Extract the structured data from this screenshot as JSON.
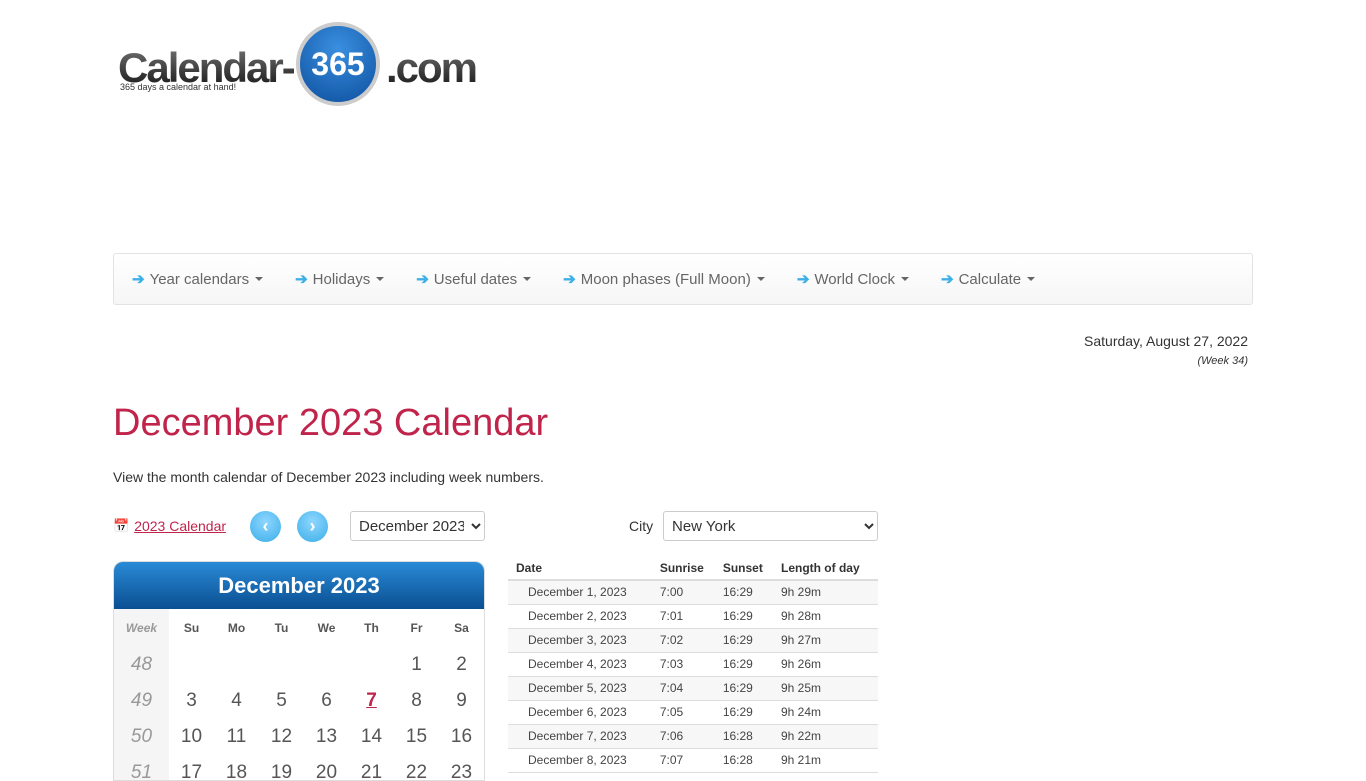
{
  "logo": {
    "left": "Calendar-",
    "number": "365",
    "right": ".com",
    "tagline": "365 days a calendar at hand!"
  },
  "nav": [
    {
      "label": "Year calendars"
    },
    {
      "label": "Holidays"
    },
    {
      "label": "Useful dates"
    },
    {
      "label": "Moon phases (Full Moon)"
    },
    {
      "label": "World Clock"
    },
    {
      "label": "Calculate"
    }
  ],
  "today": {
    "date": "Saturday, August 27, 2022",
    "week": "(Week 34)"
  },
  "page": {
    "title": "December 2023 Calendar",
    "description": "View the month calendar of December 2023 including week numbers."
  },
  "controls": {
    "year_link": "2023 Calendar",
    "prev": "‹",
    "next": "›",
    "month_select": "December 2023",
    "city_label": "City",
    "city_select": "New York"
  },
  "calendar": {
    "title": "December 2023",
    "week_header": "Week",
    "days": [
      "Su",
      "Mo",
      "Tu",
      "We",
      "Th",
      "Fr",
      "Sa"
    ],
    "weeks": [
      {
        "week": "48",
        "days": [
          "",
          "",
          "",
          "",
          "",
          "1",
          "2"
        ]
      },
      {
        "week": "49",
        "days": [
          "3",
          "4",
          "5",
          "6",
          "7",
          "8",
          "9"
        ]
      },
      {
        "week": "50",
        "days": [
          "10",
          "11",
          "12",
          "13",
          "14",
          "15",
          "16"
        ]
      },
      {
        "week": "51",
        "days": [
          "17",
          "18",
          "19",
          "20",
          "21",
          "22",
          "23"
        ]
      }
    ],
    "highlight": "7",
    "accent": "#c0244b",
    "header_color": "#0a4f92"
  },
  "sun": {
    "headers": [
      "Date",
      "Sunrise",
      "Sunset",
      "Length of day"
    ],
    "rows": [
      [
        "December 1, 2023",
        "7:00",
        "16:29",
        "9h 29m"
      ],
      [
        "December 2, 2023",
        "7:01",
        "16:29",
        "9h 28m"
      ],
      [
        "December 3, 2023",
        "7:02",
        "16:29",
        "9h 27m"
      ],
      [
        "December 4, 2023",
        "7:03",
        "16:29",
        "9h 26m"
      ],
      [
        "December 5, 2023",
        "7:04",
        "16:29",
        "9h 25m"
      ],
      [
        "December 6, 2023",
        "7:05",
        "16:29",
        "9h 24m"
      ],
      [
        "December 7, 2023",
        "7:06",
        "16:28",
        "9h 22m"
      ],
      [
        "December 8, 2023",
        "7:07",
        "16:28",
        "9h 21m"
      ]
    ]
  }
}
